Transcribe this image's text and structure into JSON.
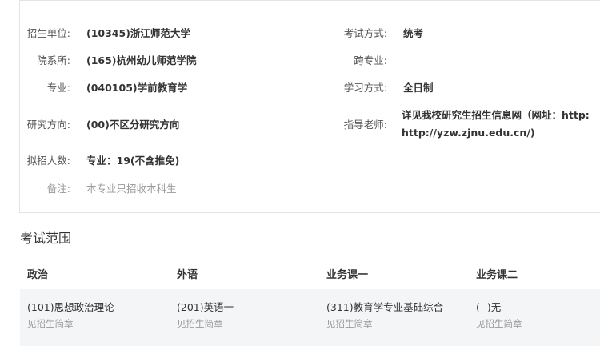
{
  "info": {
    "unit": {
      "label": "招生单位:",
      "value": "(10345)浙江师范大学"
    },
    "exam_mode": {
      "label": "考试方式:",
      "value": "统考"
    },
    "department": {
      "label": "院系所:",
      "value": "(165)杭州幼儿师范学院"
    },
    "cross_major": {
      "label": "跨专业:",
      "value": ""
    },
    "major": {
      "label": "专业:",
      "value": "(040105)学前教育学"
    },
    "study_mode": {
      "label": "学习方式:",
      "value": "全日制"
    },
    "research_direction": {
      "label": "研究方向:",
      "value": "(00)不区分研究方向"
    },
    "advisor": {
      "label": "指导老师:",
      "value_line1": "详见我校研究生招生信息网（网址：http:",
      "value_line2": "http://yzw.zjnu.edu.cn/)"
    },
    "planned": {
      "label": "拟招人数:",
      "value": "专业：19(不含推免)"
    },
    "remarks": {
      "label": "备注:",
      "value": "本专业只招收本科生"
    }
  },
  "exam_scope": {
    "title": "考试范围",
    "headers": [
      "政治",
      "外语",
      "业务课一",
      "业务课二"
    ],
    "subjects": [
      {
        "name": "(101)思想政治理论",
        "note": "见招生简章"
      },
      {
        "name": "(201)英语一",
        "note": "见招生简章"
      },
      {
        "name": "(311)教育学专业基础综合",
        "note": "见招生简章"
      },
      {
        "name": "(--)无",
        "note": "见招生简章"
      }
    ]
  }
}
